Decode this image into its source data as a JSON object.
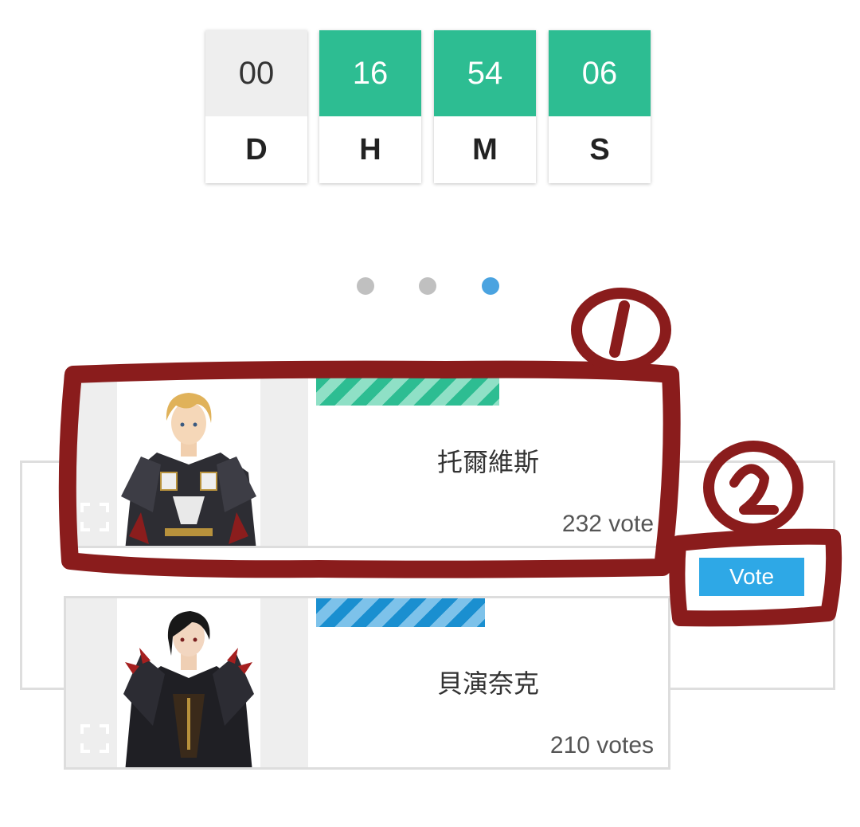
{
  "countdown": {
    "days": "00",
    "hours": "16",
    "minutes": "54",
    "seconds": "06",
    "labels": {
      "days": "D",
      "hours": "H",
      "minutes": "M",
      "seconds": "S"
    }
  },
  "carousel": {
    "dot_count": 3,
    "active_index": 2
  },
  "candidates": [
    {
      "name": "托爾維斯",
      "votes": "232 vote",
      "bar_color": "#2dbd92"
    },
    {
      "name": "貝演奈克",
      "votes": "210 votes",
      "bar_color": "#1a8fd0"
    }
  ],
  "vote_button": {
    "label": "Vote",
    "color": "#2ea8e6"
  },
  "annotations": {
    "marker_1": "①",
    "marker_2": "②",
    "color": "#8a1c1c"
  }
}
